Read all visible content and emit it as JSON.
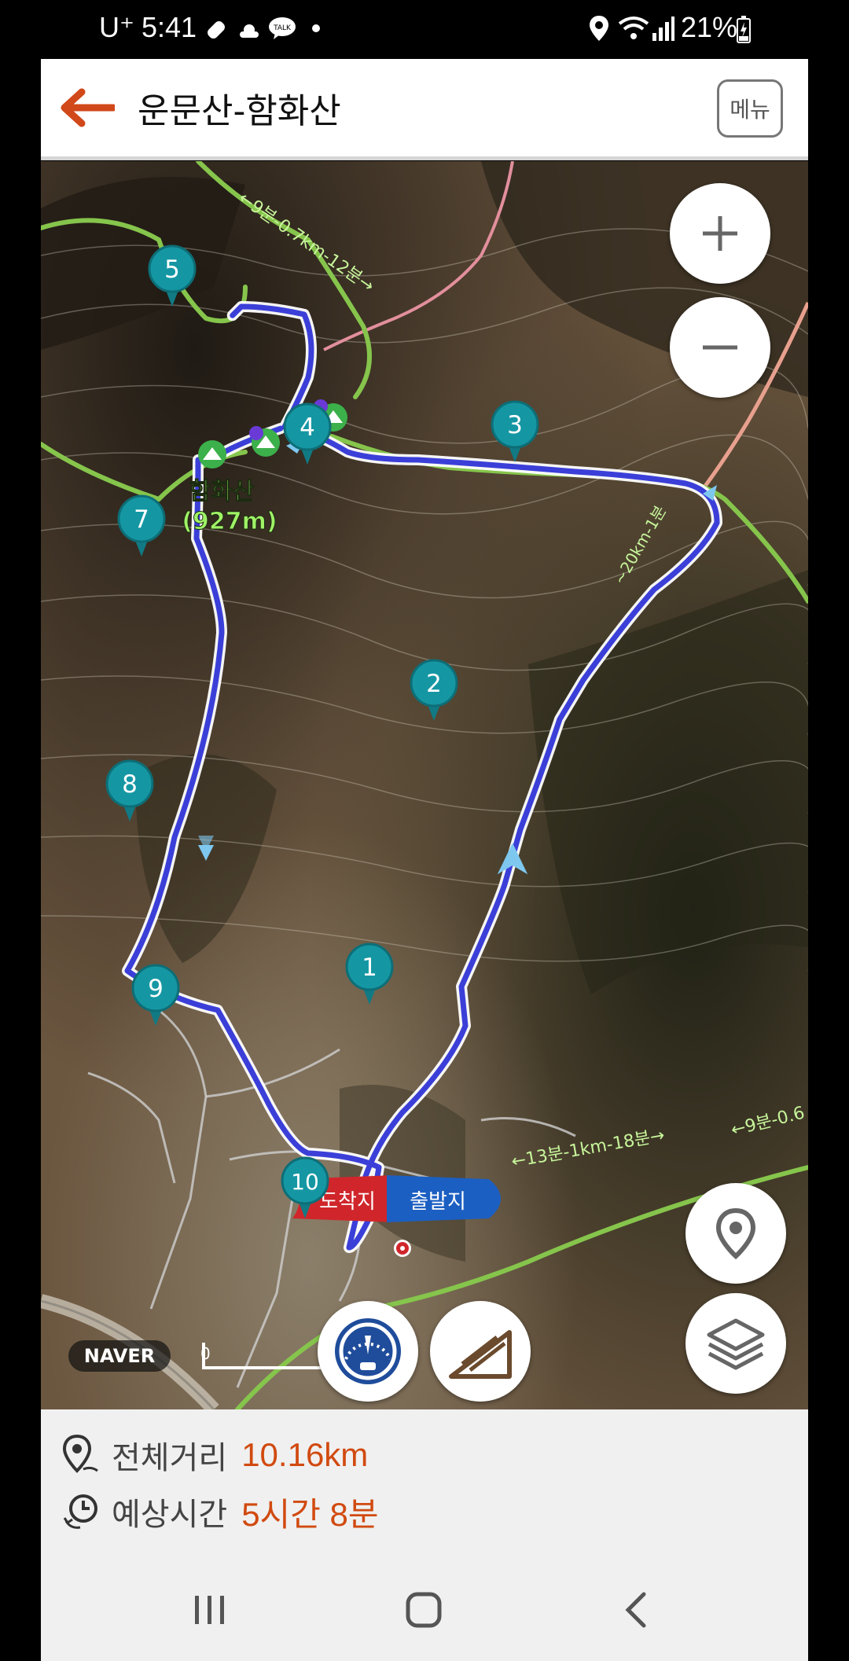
{
  "status_bar": {
    "carrier": "U⁺",
    "time": "5:41",
    "battery": "21%",
    "icons": [
      "tag-icon",
      "weather-icon",
      "kakaotalk-icon",
      "dot-icon",
      "location-icon",
      "wifi-icon",
      "signal-icon",
      "battery-charging-icon"
    ]
  },
  "header": {
    "title": "운문산-함화산",
    "menu_label": "메뉴"
  },
  "map": {
    "route_color": "#3b3fd8",
    "trail_color": "#7cc54a",
    "waypoints": [
      "1",
      "2",
      "3",
      "4",
      "5",
      "7",
      "8",
      "9",
      "10"
    ],
    "peak_label": "함화산",
    "peak_alt": "(927m)",
    "trail_labels": [
      "←9분-0.7km-12분→",
      "←13분-1km-18분→",
      "←9분-0.6",
      "~20km-1분"
    ],
    "start_label": "출발지",
    "end_label": "도착지",
    "scale_label": "0",
    "provider": "NAVER",
    "buttons": [
      "zoom-in",
      "zoom-out",
      "my-location",
      "layers",
      "speedometer",
      "slope"
    ]
  },
  "info": {
    "distance_label": "전체거리",
    "distance_value": "10.16km",
    "time_label": "예상시간",
    "time_value": "5시간 8분"
  }
}
